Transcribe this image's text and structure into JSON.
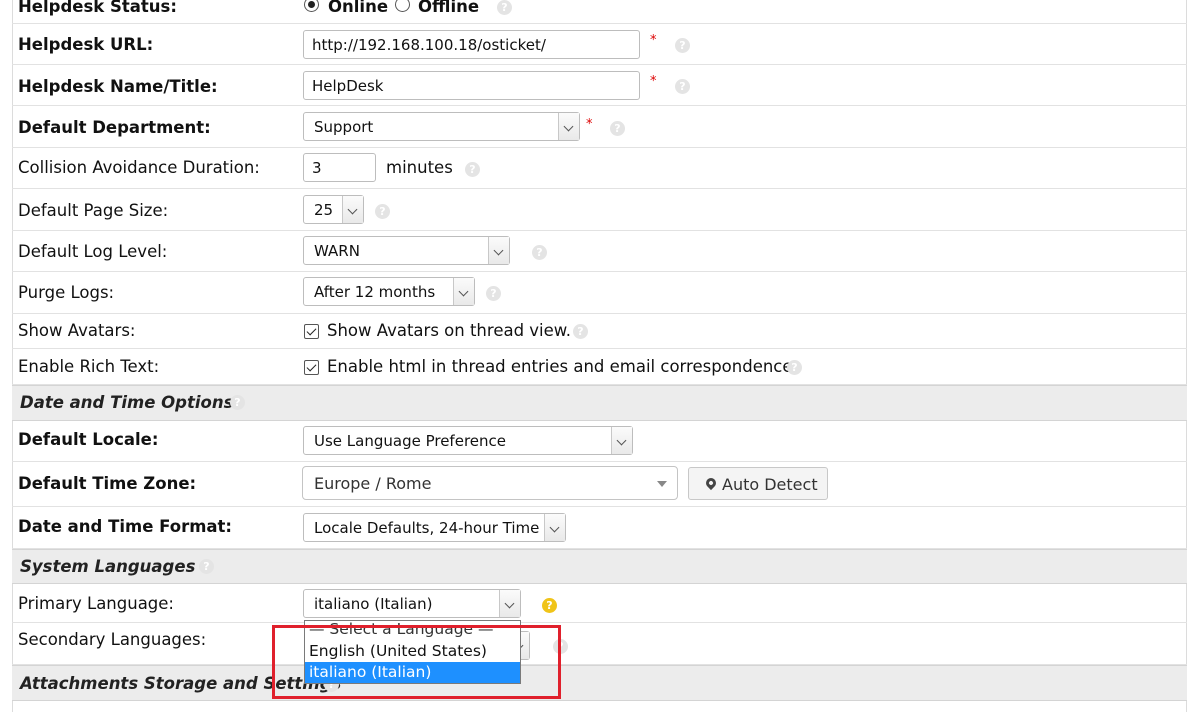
{
  "general": {
    "status": {
      "label": "Helpdesk Status:",
      "online": "Online",
      "offline": "Offline",
      "selected": "Online"
    },
    "url": {
      "label": "Helpdesk URL:",
      "value": "http://192.168.100.18/osticket/"
    },
    "name": {
      "label": "Helpdesk Name/Title:",
      "value": "HelpDesk"
    },
    "department": {
      "label": "Default Department:",
      "value": "Support"
    },
    "collision": {
      "label": "Collision Avoidance Duration:",
      "value": "3",
      "unit": "minutes"
    },
    "page_size": {
      "label": "Default Page Size:",
      "value": "25"
    },
    "log_level": {
      "label": "Default Log Level:",
      "value": "WARN"
    },
    "purge_logs": {
      "label": "Purge Logs:",
      "value": "After 12 months"
    },
    "avatars": {
      "label": "Show Avatars:",
      "checkbox_label": "Show Avatars on thread view.",
      "checked": true
    },
    "rich_text": {
      "label": "Enable Rich Text:",
      "checkbox_label": "Enable html in thread entries and email correspondence.",
      "checked": true
    },
    "required_mark": "*"
  },
  "datetime": {
    "section_title": "Date and Time Options",
    "locale": {
      "label": "Default Locale:",
      "value": "Use Language Preference"
    },
    "timezone": {
      "label": "Default Time Zone:",
      "value": "Europe / Rome",
      "auto_detect": "Auto Detect"
    },
    "format": {
      "label": "Date and Time Format:",
      "value": "Locale Defaults, 24-hour Time"
    }
  },
  "languages": {
    "section_title": "System Languages",
    "primary": {
      "label": "Primary Language:",
      "value": "italiano (Italian)"
    },
    "secondary": {
      "label": "Secondary Languages:"
    },
    "dropdown_options": [
      "— Select a Language —",
      "English (United States)",
      "italiano (Italian)"
    ],
    "dropdown_selected": "italiano (Italian)"
  },
  "attachments": {
    "section_title": "Attachments Storage and Settings"
  },
  "help_glyph": "?",
  "colors": {
    "highlight": "#e0202c",
    "option_selected": "#1e90ff",
    "help_active": "#f0c419",
    "required": "#dd0000"
  }
}
